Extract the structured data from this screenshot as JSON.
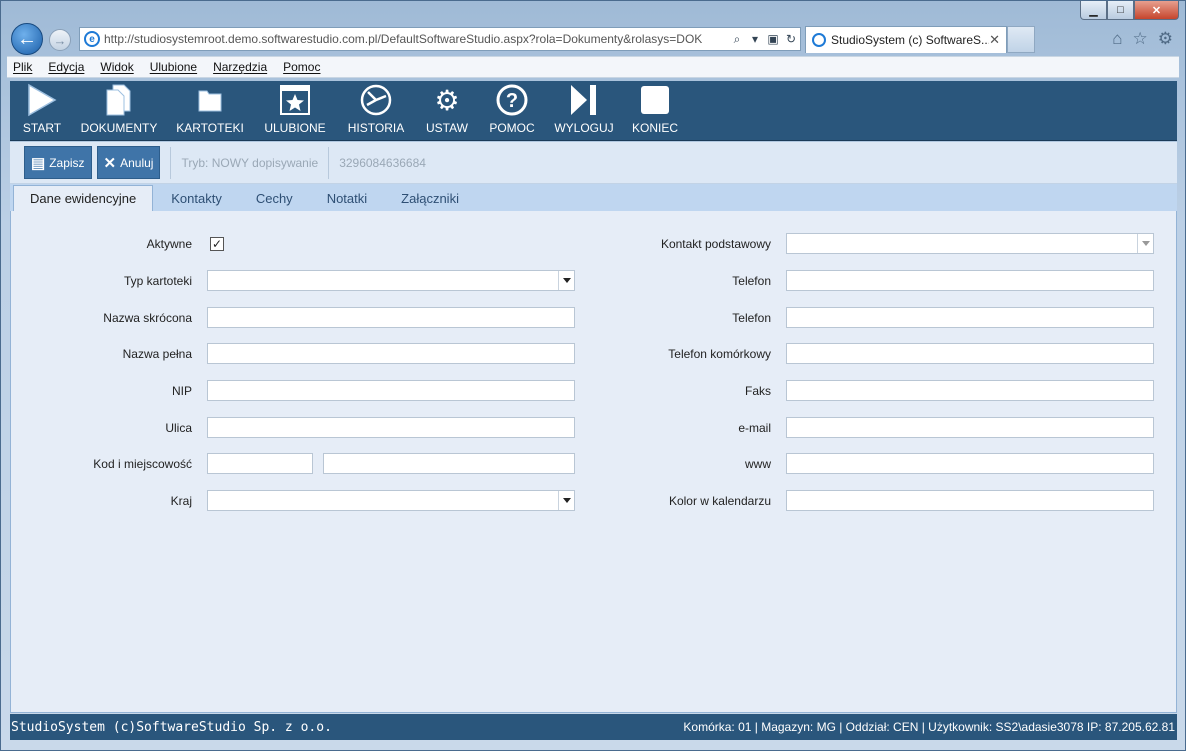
{
  "window": {
    "minimize": "▁",
    "maximize": "□",
    "close": "✕"
  },
  "browser": {
    "back": "←",
    "forward": "→",
    "url": "http://studiosystemroot.demo.softwarestudio.com.pl/DefaultSoftwareStudio.aspx?rola=Dokumenty&rolasys=DOK",
    "tab_title": "StudioSystem (c) SoftwareS...",
    "tab_close": "✕",
    "address_icons": [
      "search-icon",
      "dropdown-icon",
      "compat-icon",
      "refresh-icon"
    ],
    "right_icons": [
      "home-icon",
      "star-icon",
      "gear-icon"
    ]
  },
  "menu": [
    "Plik",
    "Edycja",
    "Widok",
    "Ulubione",
    "Narzędzia",
    "Pomoc"
  ],
  "toolbar": [
    {
      "label": "START",
      "icon": "play-icon"
    },
    {
      "label": "DOKUMENTY",
      "icon": "documents-icon"
    },
    {
      "label": "KARTOTEKI",
      "icon": "folder-icon"
    },
    {
      "label": "ULUBIONE",
      "icon": "star-icon"
    },
    {
      "label": "HISTORIA",
      "icon": "history-icon"
    },
    {
      "label": "USTAW",
      "icon": "gears-icon"
    },
    {
      "label": "POMOC",
      "icon": "help-icon"
    },
    {
      "label": "WYLOGUJ",
      "icon": "logout-icon"
    },
    {
      "label": "KONIEC",
      "icon": "stop-icon"
    }
  ],
  "actions": {
    "save": "Zapisz",
    "cancel": "Anuluj",
    "mode": "Tryb: NOWY dopisywanie",
    "id": "3296084636684"
  },
  "tabs": [
    "Dane ewidencyjne",
    "Kontakty",
    "Cechy",
    "Notatki",
    "Załączniki"
  ],
  "form": {
    "left": {
      "aktywne": {
        "label": "Aktywne",
        "checked": true
      },
      "typ_kartoteki": {
        "label": "Typ kartoteki",
        "value": ""
      },
      "nazwa_skrocona": {
        "label": "Nazwa skrócona",
        "value": ""
      },
      "nazwa_pelna": {
        "label": "Nazwa pełna",
        "value": ""
      },
      "nip": {
        "label": "NIP",
        "value": ""
      },
      "ulica": {
        "label": "Ulica",
        "value": ""
      },
      "kod_miejscowosc": {
        "label": "Kod i miejscowość",
        "kod": "",
        "miejscowosc": ""
      },
      "kraj": {
        "label": "Kraj",
        "value": ""
      }
    },
    "right": {
      "kontakt_podstawowy": {
        "label": "Kontakt podstawowy",
        "value": ""
      },
      "telefon1": {
        "label": "Telefon",
        "value": ""
      },
      "telefon2": {
        "label": "Telefon",
        "value": ""
      },
      "telefon_komorkowy": {
        "label": "Telefon komórkowy",
        "value": ""
      },
      "faks": {
        "label": "Faks",
        "value": ""
      },
      "email": {
        "label": "e-mail",
        "value": ""
      },
      "www": {
        "label": "www",
        "value": ""
      },
      "kolor_kalendarz": {
        "label": "Kolor w kalendarzu",
        "value": ""
      }
    }
  },
  "footer": {
    "left": "StudioSystem (c)SoftwareStudio Sp. z o.o.",
    "right": "Komórka: 01 | Magazyn: MG | Oddział: CEN | Użytkownik: SS2\\adasie3078 IP: 87.205.62.81"
  },
  "colors": {
    "toolbar_bg": "#2a567c",
    "action_button": "#3f74a8",
    "form_bg": "#e6edf7"
  }
}
